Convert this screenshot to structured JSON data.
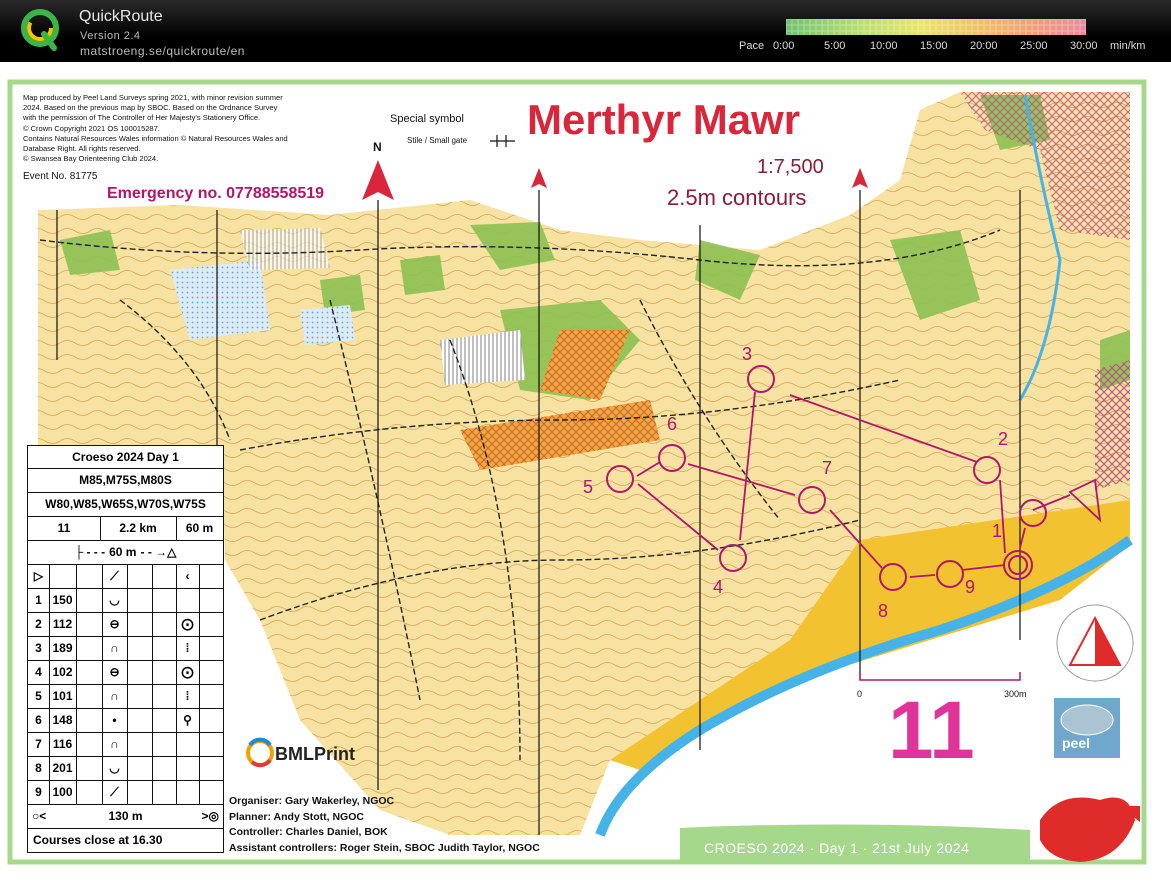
{
  "app": {
    "title": "QuickRoute",
    "version": "Version 2.4",
    "url": "matstroeng.se/quickroute/en"
  },
  "pace_scale": {
    "label": "Pace",
    "ticks": [
      "0:00",
      "5:00",
      "10:00",
      "15:00",
      "20:00",
      "25:00",
      "30:00"
    ],
    "unit": "min/km",
    "colors": [
      "#6fc36f",
      "#b9df6f",
      "#e9e56a",
      "#f0c066",
      "#f09b7a",
      "#e98aa0"
    ]
  },
  "map": {
    "title": "Merthyr Mawr",
    "scale": "1:7,500",
    "contours": "2.5m contours",
    "north_label": "N",
    "credits": [
      "Map produced by Peel Land Surveys spring 2021, with minor revision summer",
      "2024. Based on the previous map by SBOC. Based on the Ordnance Survey",
      "with the permission of The Controller of Her Majesty's Stationery Office.",
      "© Crown Copyright 2021 OS 100015287.",
      "Contains Natural Resources Wales information © Natural Resources Wales and",
      "Database Right. All rights reserved.",
      "© Swansea Bay Orienteering Club 2024."
    ],
    "special_symbol_title": "Special symbol",
    "special_symbol_item": "Stile / Small gate",
    "event_no": "Event No. 81775",
    "emergency": "Emergency no. 07788558519",
    "course_big_number": "11",
    "scale_bar": {
      "start": "0",
      "end": "300m"
    },
    "officials": [
      "Organiser: Gary Wakerley, NGOC",
      "Planner: Andy Stott, NGOC",
      "Controller: Charles Daniel, BOK",
      "Assistant controllers: Roger Stein, SBOC  Judith Taylor,  NGOC"
    ],
    "footer_banner": "CROESO 2024 · Day 1 · 21st July 2024",
    "printer_logo": "BMLPrint",
    "surveyor_logo": "peel",
    "control_labels": [
      "1",
      "2",
      "3",
      "4",
      "5",
      "6",
      "7",
      "8",
      "9"
    ]
  },
  "descriptions": {
    "event": "Croeso 2024 Day 1",
    "classes_1": "M85,M75S,M80S",
    "classes_2": "W80,W85,W65S,W70S,W75S",
    "course": "11",
    "length": "2.2 km",
    "climb": "60 m",
    "start_to_finish": "60 m",
    "controls": [
      {
        "num": "1",
        "code": "150",
        "feature": "◡",
        "detail": ""
      },
      {
        "num": "2",
        "code": "112",
        "feature": "⊖",
        "detail": "⨀"
      },
      {
        "num": "3",
        "code": "189",
        "feature": "∩",
        "detail": "⁞"
      },
      {
        "num": "4",
        "code": "102",
        "feature": "⊖",
        "detail": "⨀"
      },
      {
        "num": "5",
        "code": "101",
        "feature": "∩",
        "detail": "⁞"
      },
      {
        "num": "6",
        "code": "148",
        "feature": "•",
        "detail": "⚲"
      },
      {
        "num": "7",
        "code": "116",
        "feature": "∩",
        "detail": ""
      },
      {
        "num": "8",
        "code": "201",
        "feature": "◡",
        "detail": ""
      },
      {
        "num": "9",
        "code": "100",
        "feature": "⟋",
        "detail": ""
      }
    ],
    "finish_distance": "130 m",
    "close_text": "Courses close at 16.30"
  }
}
